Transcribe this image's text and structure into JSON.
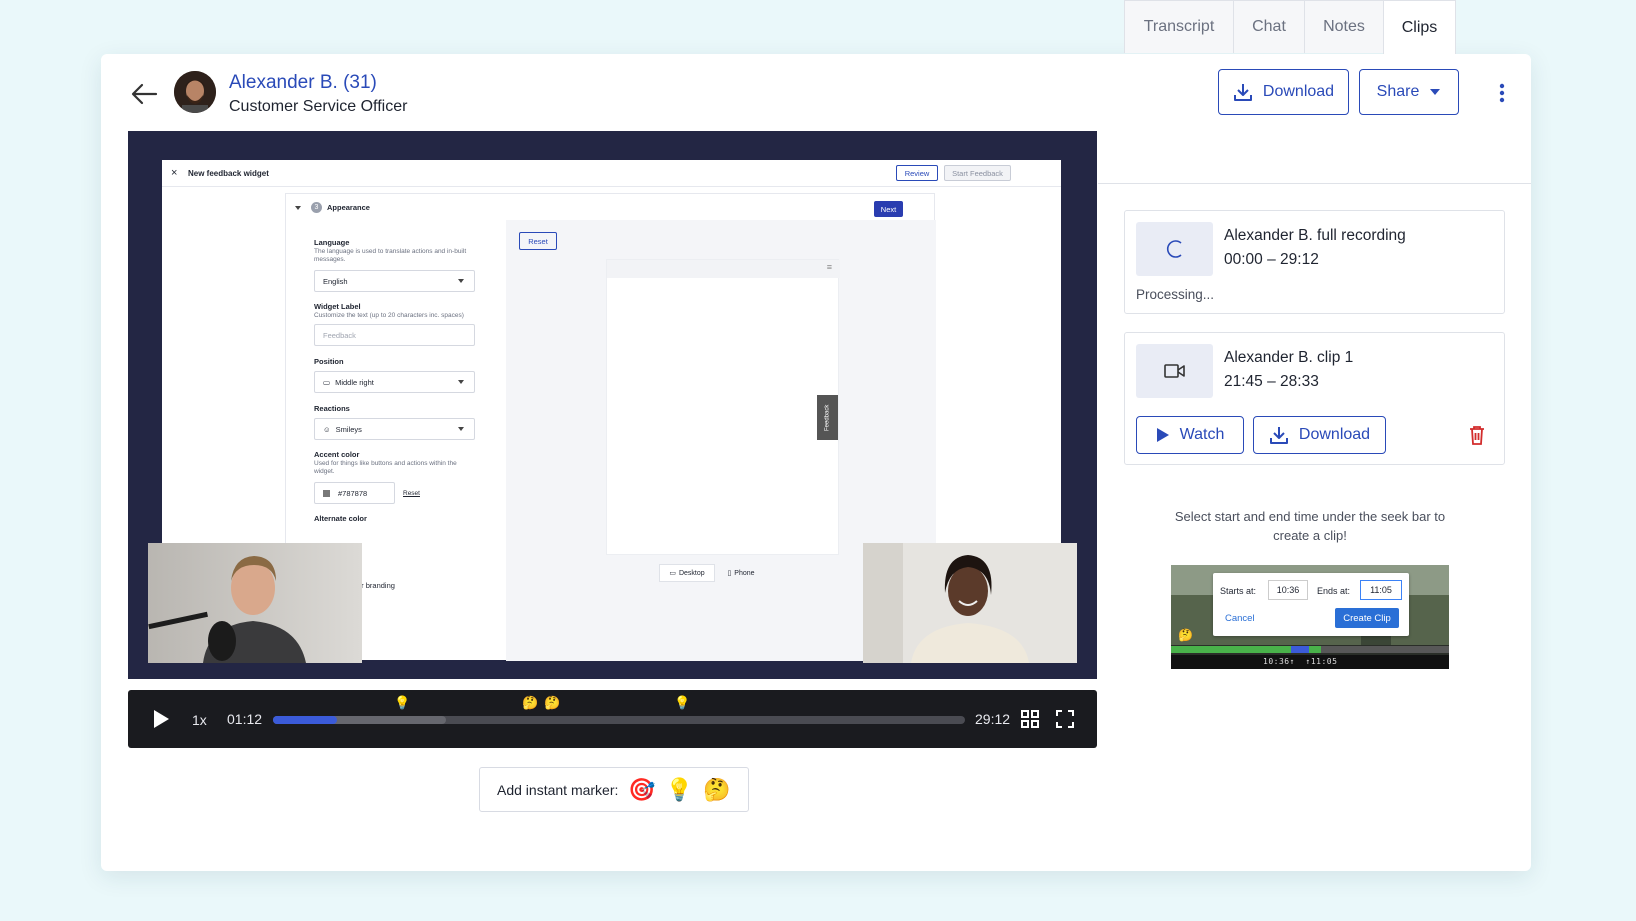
{
  "header": {
    "name": "Alexander B. (31)",
    "role": "Customer Service Officer",
    "download_label": "Download",
    "share_label": "Share"
  },
  "recording": {
    "widget_title": "New feedback widget",
    "review_label": "Review",
    "start_feedback_label": "Start Feedback",
    "section_number": "3",
    "section_title": "Appearance",
    "next_label": "Next",
    "reset_label": "Reset",
    "language_label": "Language",
    "language_help": "The language is used to translate actions and in-built messages.",
    "language_value": "English",
    "widget_label_label": "Widget Label",
    "widget_label_help": "Customize the text (up to 20 characters inc. spaces)",
    "widget_label_placeholder": "Feedback",
    "position_label": "Position",
    "position_value": "Middle right",
    "reactions_label": "Reactions",
    "reactions_value": "Smileys",
    "accent_label": "Accent color",
    "accent_help": "Used for things like buttons and actions within the widget.",
    "accent_value": "#787878",
    "accent_reset": "Reset",
    "alternate_label": "Alternate color",
    "branding_fragment": "ar branding",
    "feedback_tab": "Feedback",
    "desktop_label": "Desktop",
    "phone_label": "Phone"
  },
  "player": {
    "speed": "1x",
    "current_time": "01:12",
    "duration": "29:12",
    "progress_fraction": 0.093,
    "buffered_fraction": 0.25
  },
  "instant_marker": {
    "label": "Add instant marker:",
    "emojis": [
      "🎯",
      "💡",
      "🤔"
    ]
  },
  "tabs": [
    "Transcript",
    "Chat",
    "Notes",
    "Clips"
  ],
  "active_tab": "Clips",
  "clips": [
    {
      "title": "Alexander B. full recording",
      "time": "00:00 – 29:12",
      "status": "Processing..."
    },
    {
      "title": "Alexander B. clip 1",
      "time": "21:45 – 28:33",
      "watch_label": "Watch",
      "download_label": "Download"
    }
  ],
  "hint_text": "Select start and end time under the seek bar to create a clip!",
  "demo": {
    "starts_label": "Starts at:",
    "starts_value": "10:36",
    "ends_label": "Ends at:",
    "ends_value": "11:05",
    "cancel_label": "Cancel",
    "create_label": "Create Clip",
    "time_marks": "10:36↑  ↑11:05"
  },
  "colors": {
    "accent": "#2a4ab8",
    "danger": "#d22c2c",
    "player_bg": "#1a1b1f",
    "seek_played": "#3b5bd9"
  }
}
